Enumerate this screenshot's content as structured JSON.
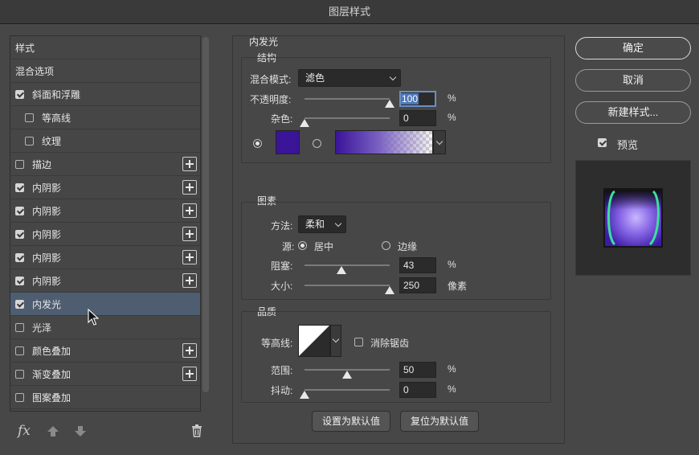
{
  "window": {
    "title": "图层样式"
  },
  "style_list": {
    "items": [
      {
        "label": "样式",
        "type": "header"
      },
      {
        "label": "混合选项",
        "type": "header"
      },
      {
        "label": "斜面和浮雕",
        "checked": true
      },
      {
        "label": "等高线",
        "checked": false,
        "indent": true
      },
      {
        "label": "纹理",
        "checked": false,
        "indent": true
      },
      {
        "label": "描边",
        "checked": false,
        "plus": true
      },
      {
        "label": "内阴影",
        "checked": true,
        "plus": true
      },
      {
        "label": "内阴影",
        "checked": true,
        "plus": true
      },
      {
        "label": "内阴影",
        "checked": true,
        "plus": true
      },
      {
        "label": "内阴影",
        "checked": true,
        "plus": true
      },
      {
        "label": "内阴影",
        "checked": true,
        "plus": true
      },
      {
        "label": "内发光",
        "checked": true,
        "selected": true
      },
      {
        "label": "光泽",
        "checked": false
      },
      {
        "label": "颜色叠加",
        "checked": false,
        "plus": true
      },
      {
        "label": "渐变叠加",
        "checked": false,
        "plus": true
      },
      {
        "label": "图案叠加",
        "checked": false
      }
    ],
    "fx_label": "fx"
  },
  "panel": {
    "title": "内发光",
    "structure": {
      "title": "结构",
      "blend_mode_label": "混合模式:",
      "blend_mode_value": "滤色",
      "opacity_label": "不透明度:",
      "opacity_value": "100",
      "opacity_unit": "%",
      "opacity_fraction": 1.0,
      "noise_label": "杂色:",
      "noise_value": "0",
      "noise_unit": "%",
      "noise_fraction": 0.0,
      "glow_color": "#3a1499"
    },
    "elements": {
      "title": "图素",
      "technique_label": "方法:",
      "technique_value": "柔和",
      "source_label": "源:",
      "source_center": "居中",
      "source_edge": "边缘",
      "choke_label": "阻塞:",
      "choke_value": "43",
      "choke_unit": "%",
      "choke_fraction": 0.43,
      "size_label": "大小:",
      "size_value": "250",
      "size_unit": "像素",
      "size_fraction": 1.0
    },
    "quality": {
      "title": "品质",
      "contour_label": "等高线:",
      "antialias_label": "消除锯齿",
      "range_label": "范围:",
      "range_value": "50",
      "range_unit": "%",
      "range_fraction": 0.5,
      "jitter_label": "抖动:",
      "jitter_value": "0",
      "jitter_unit": "%",
      "jitter_fraction": 0.0
    },
    "make_default_label": "设置为默认值",
    "reset_default_label": "复位为默认值"
  },
  "actions": {
    "ok_label": "确定",
    "cancel_label": "取消",
    "new_style_label": "新建样式...",
    "preview_label": "预览",
    "preview_checked": true
  }
}
